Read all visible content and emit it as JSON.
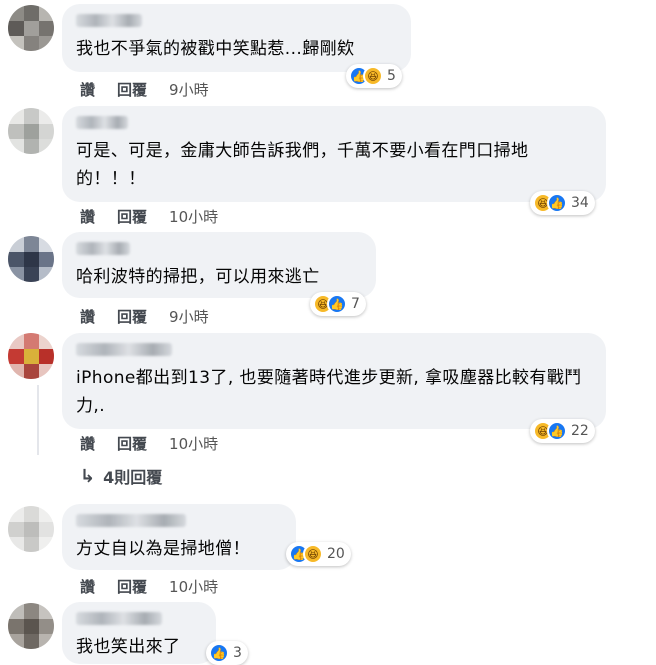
{
  "comments": [
    {
      "text": "我也不爭氣的被戳中笑點惹...歸剛欸",
      "actions": {
        "like": "讚",
        "reply": "回覆",
        "time": "9小時"
      },
      "reaction_count": "5",
      "reactions": [
        "like-icon",
        "haha-icon"
      ]
    },
    {
      "text": "可是、可是，金庸大師告訴我們，千萬不要小看在門口掃地的！！！",
      "actions": {
        "like": "讚",
        "reply": "回覆",
        "time": "10小時"
      },
      "reaction_count": "34",
      "reactions": [
        "haha-icon",
        "like-icon"
      ]
    },
    {
      "text": "哈利波特的掃把，可以用來逃亡",
      "actions": {
        "like": "讚",
        "reply": "回覆",
        "time": "9小時"
      },
      "reaction_count": "7",
      "reactions": [
        "haha-icon",
        "like-icon"
      ]
    },
    {
      "text": "iPhone都出到13了, 也要隨著時代進步更新, 拿吸塵器比較有戰鬥力,.",
      "actions": {
        "like": "讚",
        "reply": "回覆",
        "time": "10小時"
      },
      "reaction_count": "22",
      "reactions": [
        "haha-icon",
        "like-icon"
      ]
    },
    {
      "text": "方丈自以為是掃地僧！",
      "actions": {
        "like": "讚",
        "reply": "回覆",
        "time": "10小時"
      },
      "reaction_count": "20",
      "reactions": [
        "like-icon",
        "haha-icon"
      ]
    },
    {
      "text": "我也笑出來了",
      "reaction_count": "3",
      "reactions": [
        "like-icon"
      ]
    }
  ],
  "view_replies": "4則回覆",
  "colors": {
    "bubble": "#f0f2f5",
    "like": "#1877f2",
    "haha": "#f7b928",
    "meta": "#444950"
  }
}
